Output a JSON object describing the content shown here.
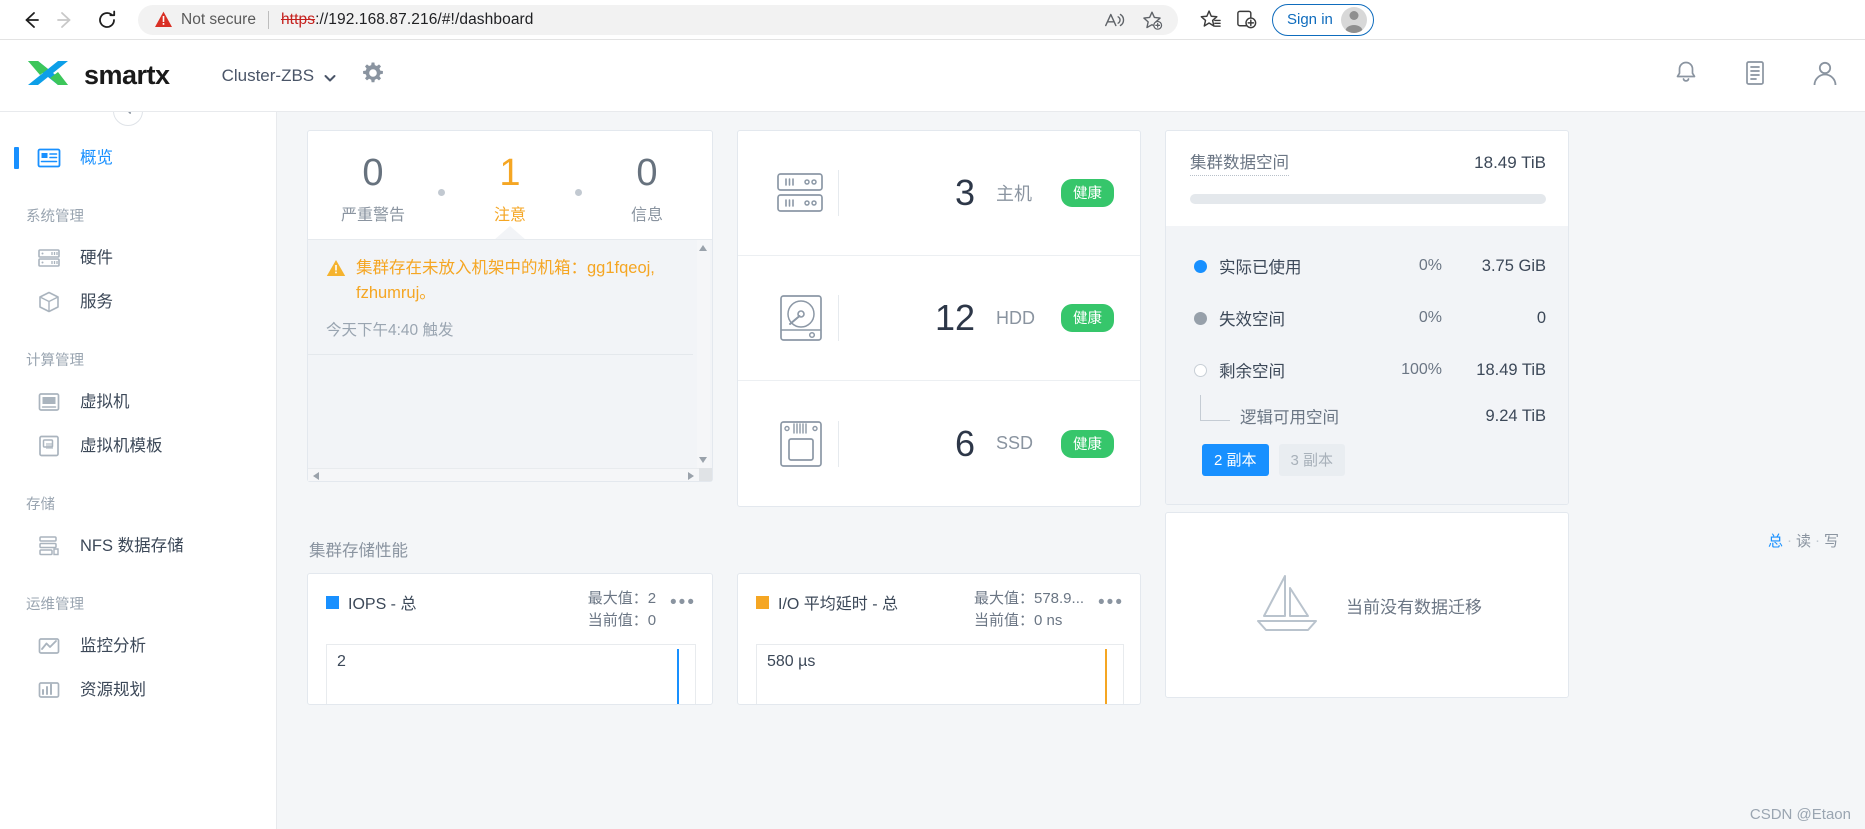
{
  "browser": {
    "back_icon": "back-arrow-icon",
    "forward_icon": "forward-arrow-icon",
    "reload_icon": "reload-icon",
    "security_label": "Not secure",
    "url_scheme": "https",
    "url_rest": "://192.168.87.216/#!/dashboard",
    "read_aloud_icon": "read-aloud-icon",
    "add_favorite_icon": "add-favorite-icon",
    "favorites_icon": "favorites-icon",
    "collections_icon": "collections-icon",
    "signin_label": "Sign in"
  },
  "header": {
    "brand": "smartx",
    "cluster": "Cluster-ZBS",
    "settings_icon": "gear-icon",
    "bell_icon": "bell-icon",
    "tasks_icon": "task-list-icon",
    "user_icon": "user-avatar-icon"
  },
  "sidebar": {
    "collapse_icon": "chevron-left-icon",
    "items": [
      {
        "label": "概览",
        "icon": "overview-icon",
        "active": true
      },
      {
        "group": "系统管理"
      },
      {
        "label": "硬件",
        "icon": "hardware-icon"
      },
      {
        "label": "服务",
        "icon": "service-icon"
      },
      {
        "group": "计算管理"
      },
      {
        "label": "虚拟机",
        "icon": "vm-icon"
      },
      {
        "label": "虚拟机模板",
        "icon": "vm-template-icon"
      },
      {
        "group": "存储"
      },
      {
        "label": "NFS 数据存储",
        "icon": "nfs-datastore-icon"
      },
      {
        "group": "运维管理"
      },
      {
        "label": "监控分析",
        "icon": "monitoring-icon"
      },
      {
        "label": "资源规划",
        "icon": "resource-planning-icon"
      }
    ]
  },
  "alerts": {
    "stats": [
      {
        "count": "0",
        "label": "严重警告",
        "tone": "normal"
      },
      {
        "count": "1",
        "label": "注意",
        "tone": "warn"
      },
      {
        "count": "0",
        "label": "信息",
        "tone": "normal"
      }
    ],
    "entry": {
      "warning_icon": "warning-triangle-icon",
      "message": "集群存在未放入机架中的机箱：gg1fqeoj, fzhumruj。",
      "time": "今天下午4:40 触发"
    }
  },
  "resources": [
    {
      "icon": "server-rack-icon",
      "count": "3",
      "unit": "主机",
      "status": "健康"
    },
    {
      "icon": "hdd-icon",
      "count": "12",
      "unit": "HDD",
      "status": "健康"
    },
    {
      "icon": "ssd-icon",
      "count": "6",
      "unit": "SSD",
      "status": "健康"
    }
  ],
  "storage": {
    "title": "集群数据空间",
    "total": "18.49 TiB",
    "legend": [
      {
        "name": "实际已使用",
        "pct": "0%",
        "value": "3.75 GiB",
        "dot": "blue"
      },
      {
        "name": "失效空间",
        "pct": "0%",
        "value": "0",
        "dot": "gray"
      },
      {
        "name": "剩余空间",
        "pct": "100%",
        "value": "18.49 TiB",
        "dot": "empty"
      }
    ],
    "sub": {
      "name": "逻辑可用空间",
      "value": "9.24 TiB"
    },
    "replica_on": "2 副本",
    "replica_off": "3 副本"
  },
  "performance": {
    "section_title": "集群存储性能",
    "toggle": {
      "total": "总",
      "read": "读",
      "write": "写",
      "sep": "·"
    },
    "charts": [
      {
        "legend_label": "IOPS - 总",
        "color": "blue",
        "max_label": "最大值：2",
        "cur_label": "当前值：0",
        "plot_value": "2",
        "menu_icon": "more-options-icon"
      },
      {
        "legend_label": "I/O 平均延时 - 总",
        "color": "orange",
        "max_label": "最大值：578.9...",
        "cur_label": "当前值：0 ns",
        "plot_value": "580 µs",
        "menu_icon": "more-options-icon"
      }
    ]
  },
  "migration": {
    "icon": "sailboat-icon",
    "text": "当前没有数据迁移"
  },
  "watermark": "CSDN @Etaon",
  "colors": {
    "accent": "#1890ff",
    "warning": "#f5a623",
    "success": "#36c66b",
    "page_bg": "#f4f6f8"
  }
}
